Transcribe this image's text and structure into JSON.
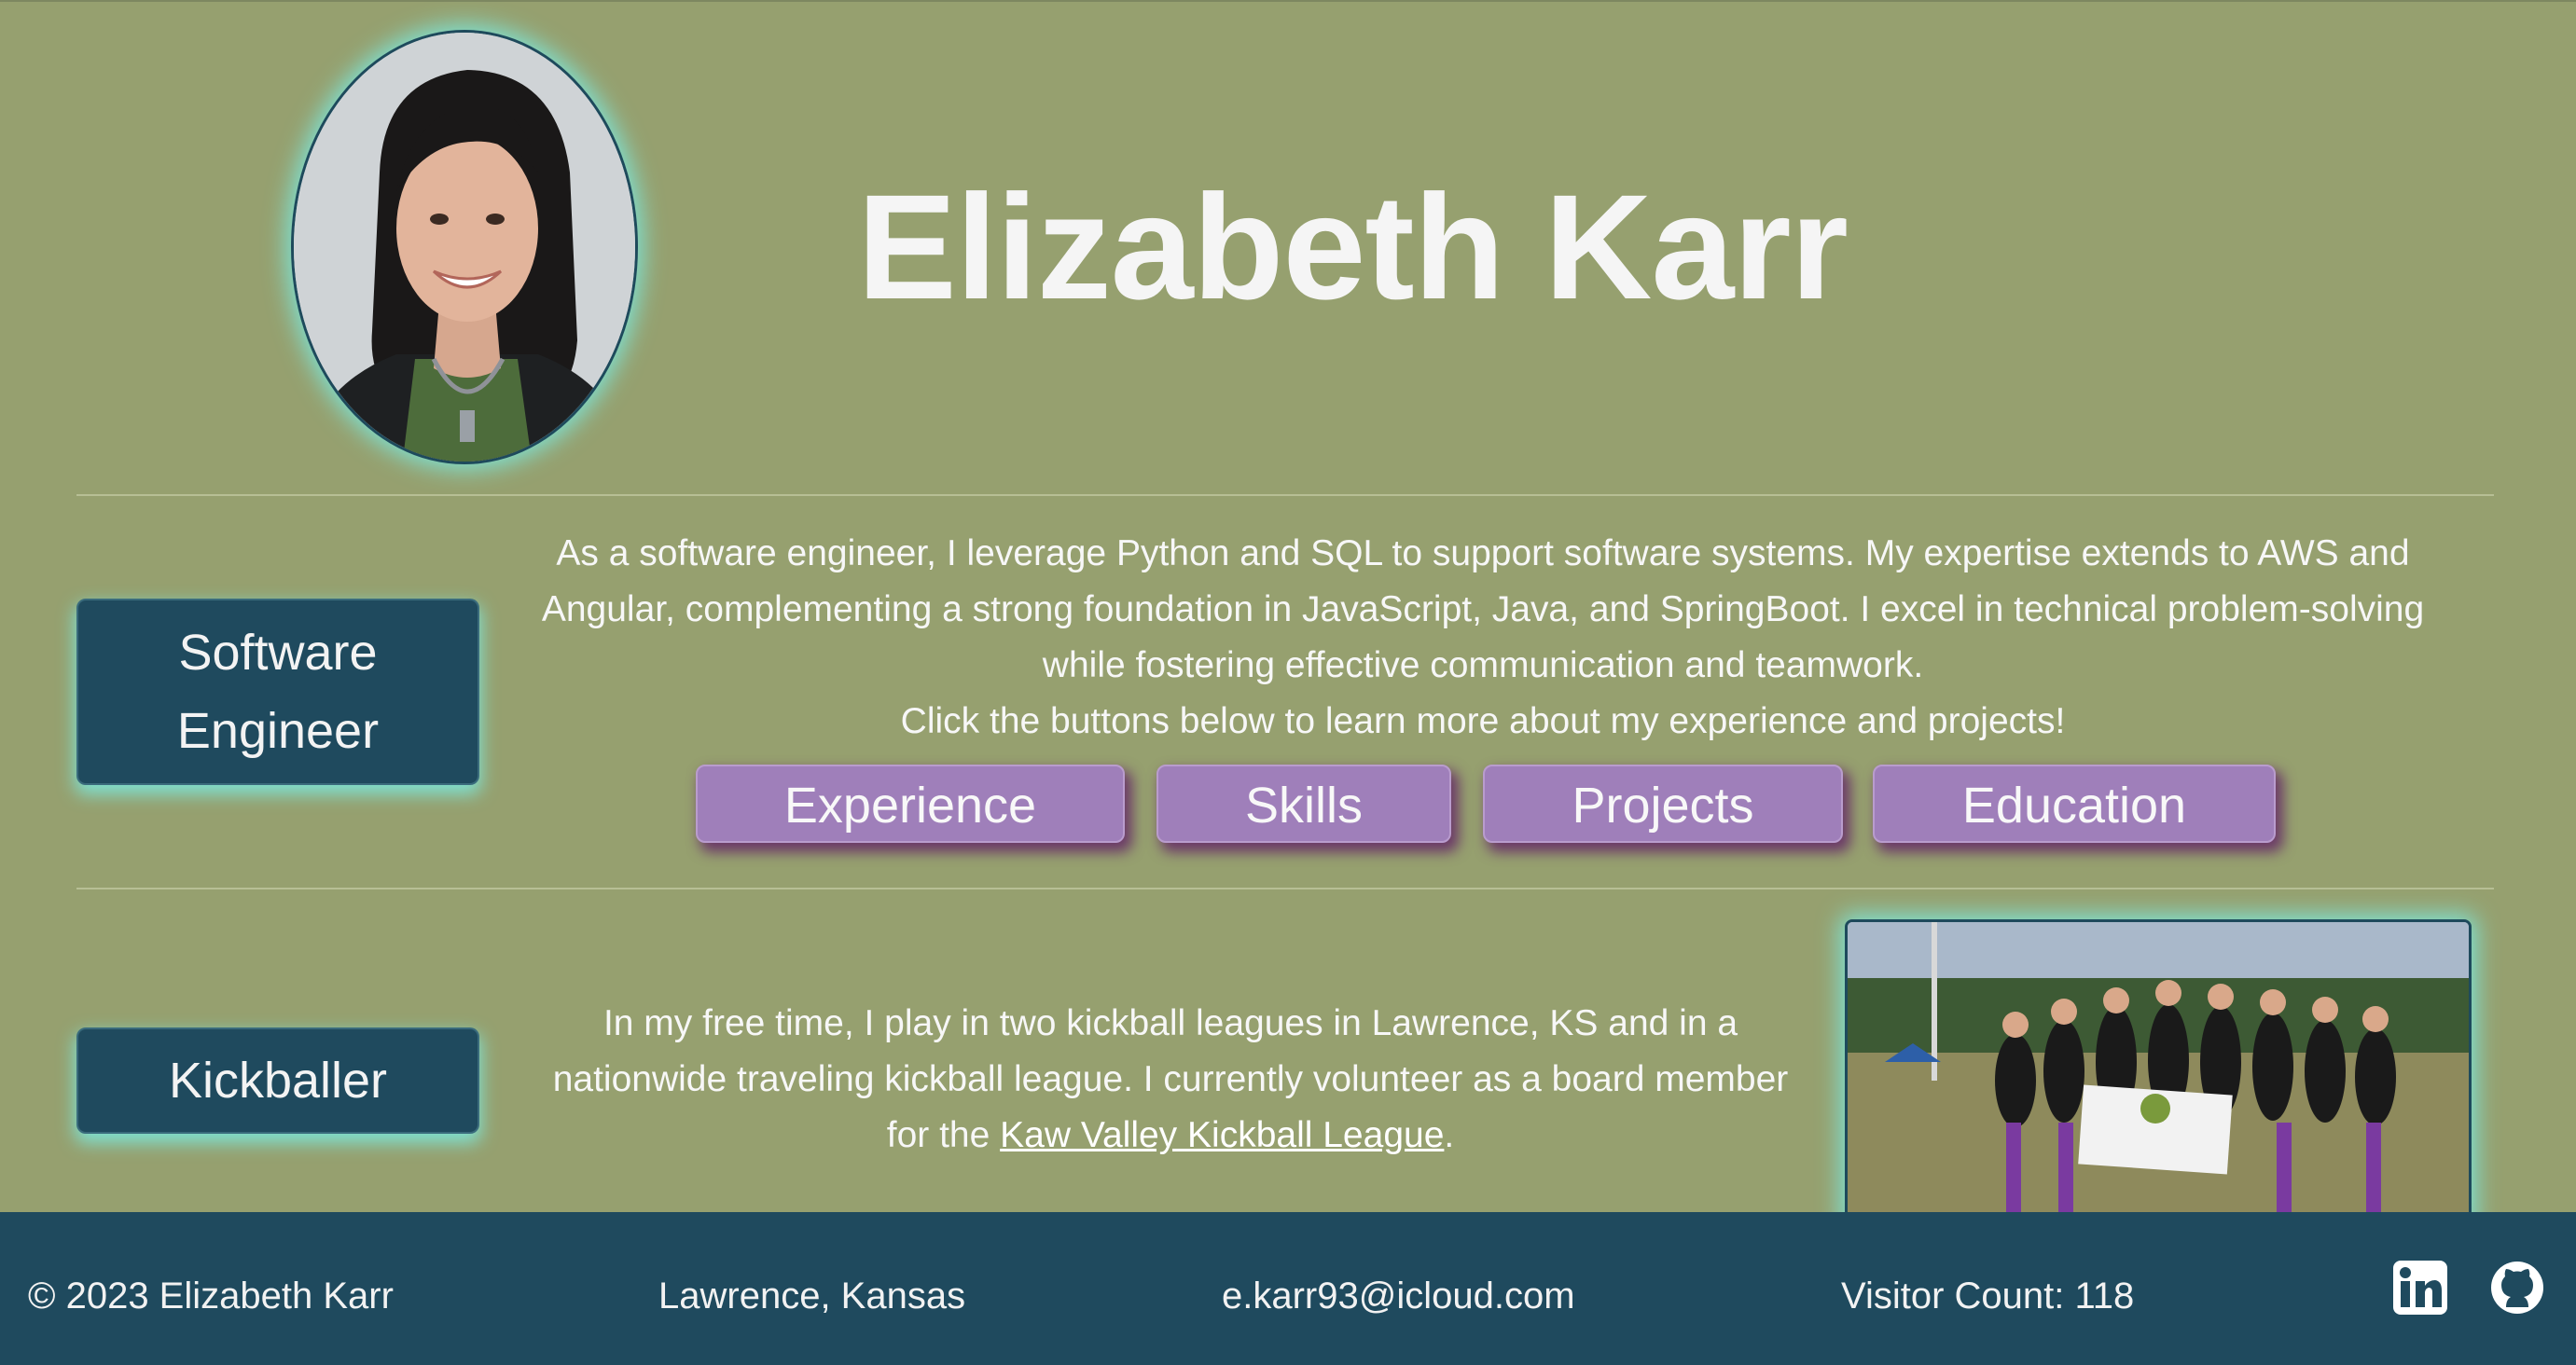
{
  "header": {
    "name": "Elizabeth Karr"
  },
  "about": {
    "role_label_line1": "Software",
    "role_label_line2": "Engineer",
    "paragraph_lines": [
      "As a software engineer, I leverage Python and SQL to support software systems. My expertise extends to AWS and",
      "Angular, complementing a strong foundation in JavaScript, Java, and SpringBoot. I excel in technical problem-solving",
      "while fostering effective communication and teamwork."
    ],
    "cta": "Click the buttons below to learn more about my experience and projects!",
    "buttons": {
      "experience": "Experience",
      "skills": "Skills",
      "projects": "Projects",
      "education": "Education"
    }
  },
  "hobby": {
    "role_label": "Kickballer",
    "line1": "In my free time, I play in two kickball leagues in Lawrence, KS and in a",
    "line2": "nationwide traveling kickball league. I currently volunteer as a board member",
    "line3_prefix": "for the ",
    "link_text": "Kaw Valley Kickball League",
    "line3_suffix": "."
  },
  "footer": {
    "copyright": "© 2023 Elizabeth Karr",
    "location": "Lawrence, Kansas",
    "email": "e.karr93@icloud.com",
    "visitor_count": "Visitor Count: 118",
    "icons": [
      "linkedin-icon",
      "github-icon"
    ]
  },
  "colors": {
    "background": "#96a06f",
    "navy": "#1f4a5e",
    "purple": "#9f7fba",
    "glow": "#7fe0d0"
  }
}
